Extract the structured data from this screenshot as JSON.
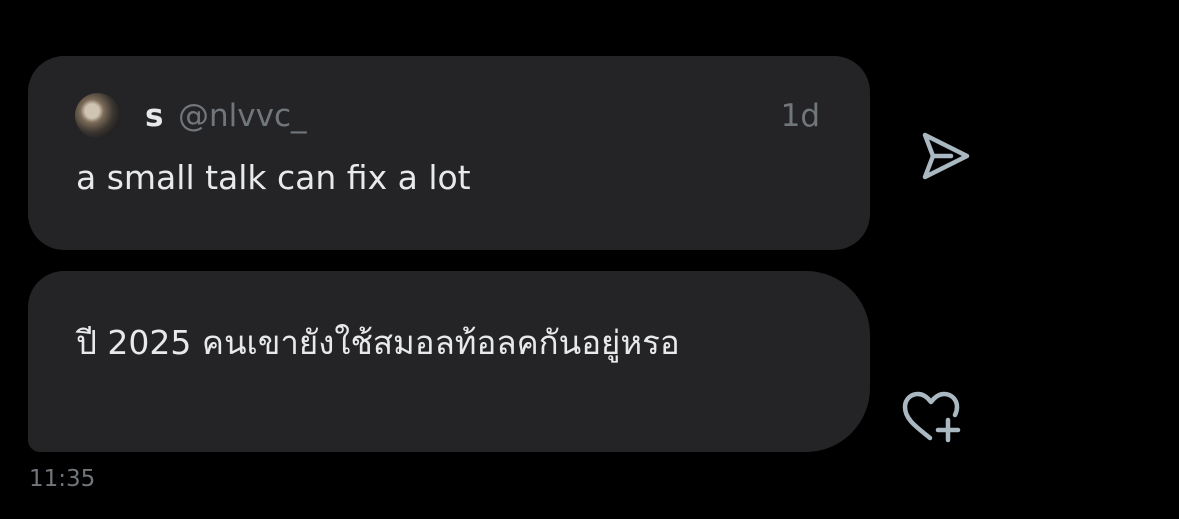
{
  "quoted_post": {
    "author_name": "s",
    "author_handle": "@nlvvc_",
    "age": "1d",
    "text": "a small talk can fix a lot"
  },
  "message": {
    "text": "ปี 2025 คนเขายังใช้สมอลท้อลคกันอยู่หรอ",
    "time": "11:35"
  },
  "icons": {
    "share": "send-arrow-icon",
    "react": "heart-plus-icon"
  },
  "colors": {
    "background": "#000000",
    "bubble": "#242427",
    "text_primary": "#e7e9ea",
    "text_secondary": "#71767b",
    "icon": "#aab8c2"
  }
}
